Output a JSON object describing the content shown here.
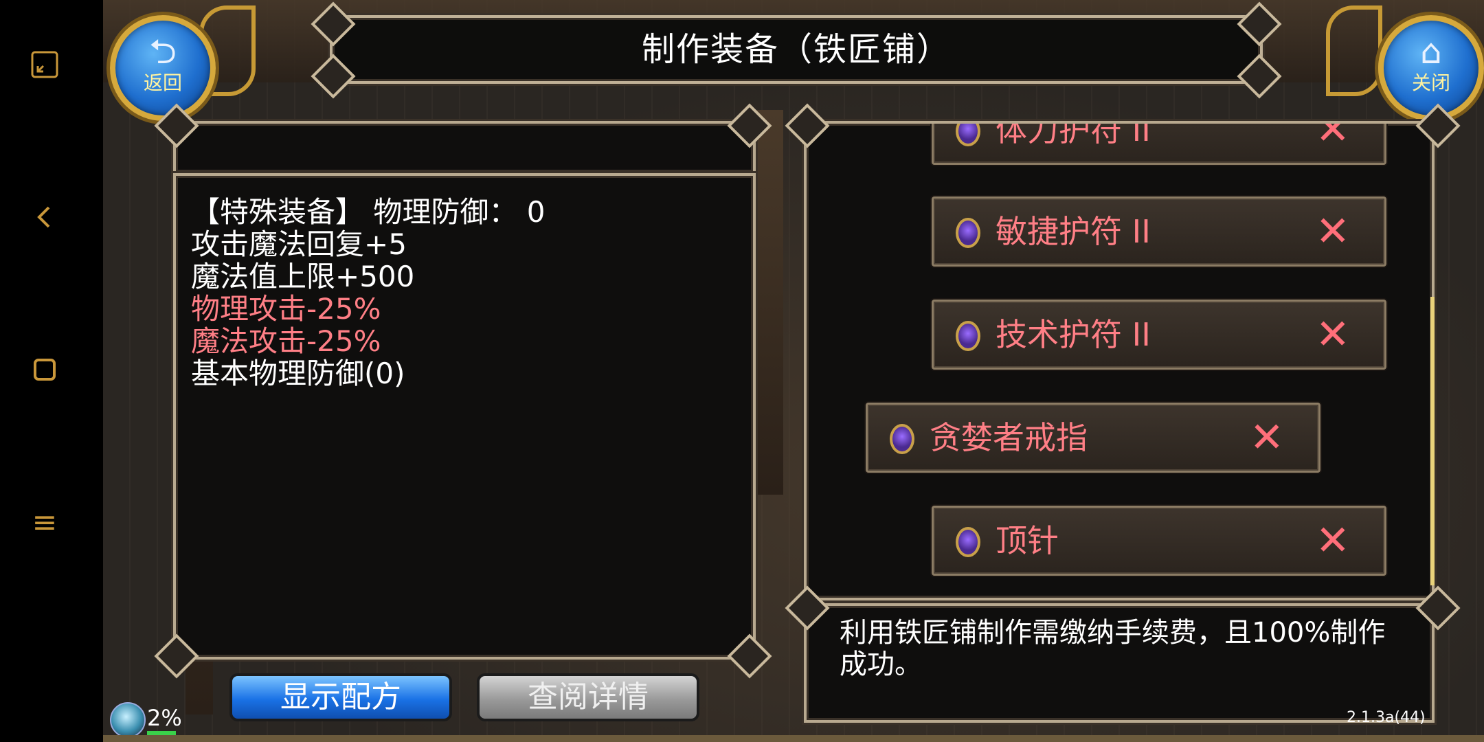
{
  "system_nav": {
    "icons": [
      "fullscreen-icon",
      "back-icon",
      "home-icon",
      "menu-icon"
    ],
    "menu_glyph": "≡"
  },
  "header": {
    "title": "制作装备（铁匠铺）",
    "back_label": "返回",
    "close_label": "关闭"
  },
  "detail": {
    "lines": [
      {
        "text": "【特殊装备】 物理防御：  0",
        "color": "#ffffff"
      },
      {
        "text": "攻击魔法回复+5",
        "color": "#ffffff"
      },
      {
        "text": "魔法值上限+500",
        "color": "#ffffff"
      },
      {
        "text": "物理攻击-25%",
        "color": "#ff7f86"
      },
      {
        "text": "魔法攻击-25%",
        "color": "#ff7f86"
      },
      {
        "text": "基本物理防御(0)",
        "color": "#ffffff"
      }
    ]
  },
  "recipes": [
    {
      "name": "体力护符 II",
      "mark": "✕"
    },
    {
      "name": "敏捷护符 II",
      "mark": "✕"
    },
    {
      "name": "技术护符 II",
      "mark": "✕"
    },
    {
      "name": "贪婪者戒指",
      "mark": "✕"
    },
    {
      "name": "顶针",
      "mark": "✕"
    }
  ],
  "description": "利用铁匠铺制作需缴纳手续费，且100%制作成功。",
  "buttons": {
    "show_recipe": "显示配方",
    "view_details": "查阅详情"
  },
  "status": {
    "percent": "2%",
    "version": "2.1.3a(44)"
  },
  "colors": {
    "accent_blue": "#1a72e6",
    "warning_red": "#ff7f86",
    "frame": "#b8a98f"
  }
}
